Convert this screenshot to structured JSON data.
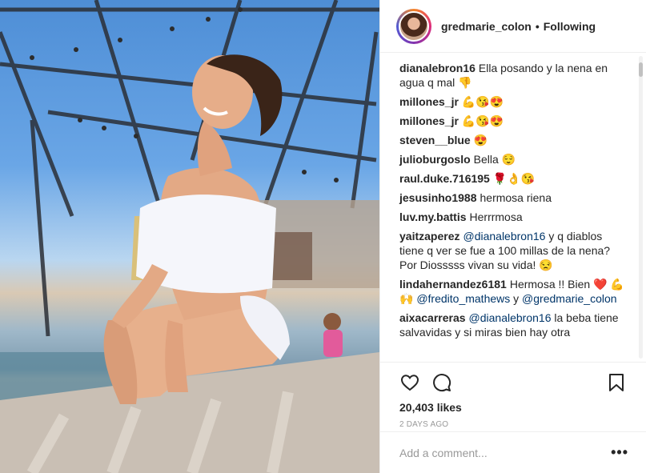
{
  "post": {
    "image_alt": "Woman in white off-shoulder swimsuit posing by a screened pool"
  },
  "header": {
    "username": "gredmarie_colon",
    "separator": "•",
    "follow_status": "Following"
  },
  "comments": [
    {
      "user": "dianalebron16",
      "parts": [
        {
          "t": "text",
          "v": "Ella posando y la nena en agua q mal 👎"
        }
      ]
    },
    {
      "user": "millones_jr",
      "parts": [
        {
          "t": "text",
          "v": "💪😘😍"
        }
      ]
    },
    {
      "user": "millones_jr",
      "parts": [
        {
          "t": "text",
          "v": "💪😘😍"
        }
      ]
    },
    {
      "user": "steven__blue",
      "parts": [
        {
          "t": "text",
          "v": "😍"
        }
      ]
    },
    {
      "user": "julioburgoslo",
      "parts": [
        {
          "t": "text",
          "v": "Bella 😌"
        }
      ]
    },
    {
      "user": "raul.duke.716195",
      "parts": [
        {
          "t": "text",
          "v": "🌹👌😘"
        }
      ]
    },
    {
      "user": "jesusinho1988",
      "parts": [
        {
          "t": "text",
          "v": "hermosa riena"
        }
      ]
    },
    {
      "user": "luv.my.battis",
      "parts": [
        {
          "t": "text",
          "v": "Herrrmosa"
        }
      ]
    },
    {
      "user": "yaitzaperez",
      "parts": [
        {
          "t": "mention",
          "v": "@dianalebron16"
        },
        {
          "t": "text",
          "v": " y q diablos tiene q ver se fue a 100 millas de la nena? Por Diosssss vivan su vida! 😒"
        }
      ]
    },
    {
      "user": "lindahernandez6181",
      "parts": [
        {
          "t": "text",
          "v": "Hermosa !! Bien ❤️ 💪🙌 "
        },
        {
          "t": "mention",
          "v": "@fredito_mathews"
        },
        {
          "t": "text",
          "v": " y "
        },
        {
          "t": "mention",
          "v": "@gredmarie_colon"
        }
      ]
    },
    {
      "user": "aixacarreras",
      "parts": [
        {
          "t": "mention",
          "v": "@dianalebron16"
        },
        {
          "t": "text",
          "v": " la beba tiene salvavidas y si miras bien hay otra"
        }
      ]
    }
  ],
  "actions": {
    "like_icon": "heart-icon",
    "comment_icon": "comment-icon",
    "save_icon": "bookmark-icon"
  },
  "likes_text": "20,403 likes",
  "time_text": "2 DAYS AGO",
  "add_comment": {
    "placeholder": "Add a comment...",
    "more_label": "•••"
  }
}
